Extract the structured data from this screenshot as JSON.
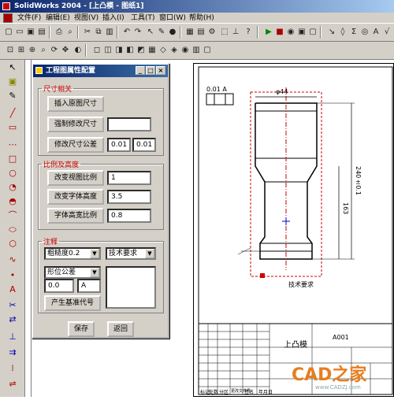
{
  "window": {
    "title": "SolidWorks 2004 - [上凸模 - 图纸1]"
  },
  "menu": {
    "items": [
      "文件(F)",
      "编辑(E)",
      "视图(V)",
      "插入(I)",
      "工具(T)",
      "窗口(W)",
      "帮助(H)"
    ]
  },
  "dialog": {
    "title": "工程图属性配置",
    "section_dimension": "尺寸相关",
    "btn_insert_dims": "插入原图尺寸",
    "btn_force_dim": "强制修改尺寸",
    "force_dim_value": "",
    "btn_modify_tol": "修改尺寸公差",
    "tol_upper": "0.01",
    "tol_lower": "0.01",
    "section_scale": "比例及高度",
    "btn_view_scale": "改变视图比例",
    "view_scale_value": "1",
    "btn_font_height": "改变字体高度",
    "font_height_value": "3.5",
    "btn_font_ratio": "字体高宽比例",
    "font_ratio_value": "0.8",
    "section_note": "注释",
    "roughness_select": "粗糙度0.2",
    "tech_req_select": "技术要求",
    "position_tol_select": "形位公差",
    "tol_value1": "0.0",
    "tol_value2": "A",
    "btn_datum": "产生基准代号",
    "btn_save": "保存",
    "btn_return": "返回"
  },
  "drawing": {
    "dim_diameter": "φ44",
    "dim_length": "240±0.1",
    "dim_mid": "163",
    "note_label": "技术要求",
    "title_part": "上凸模",
    "title_code": "A001",
    "table_row_labels": [
      "标记",
      "处数",
      "分区",
      "更改文件号",
      "签名",
      "年月日"
    ],
    "tol_frame": "0.01  A"
  },
  "watermark": {
    "text": "CAD之家",
    "url": "www.CADZJ.com"
  },
  "colors": {
    "title_bar": "#0a246a",
    "section_legend": "#cc0000",
    "drawing_red": "#cc0000"
  }
}
